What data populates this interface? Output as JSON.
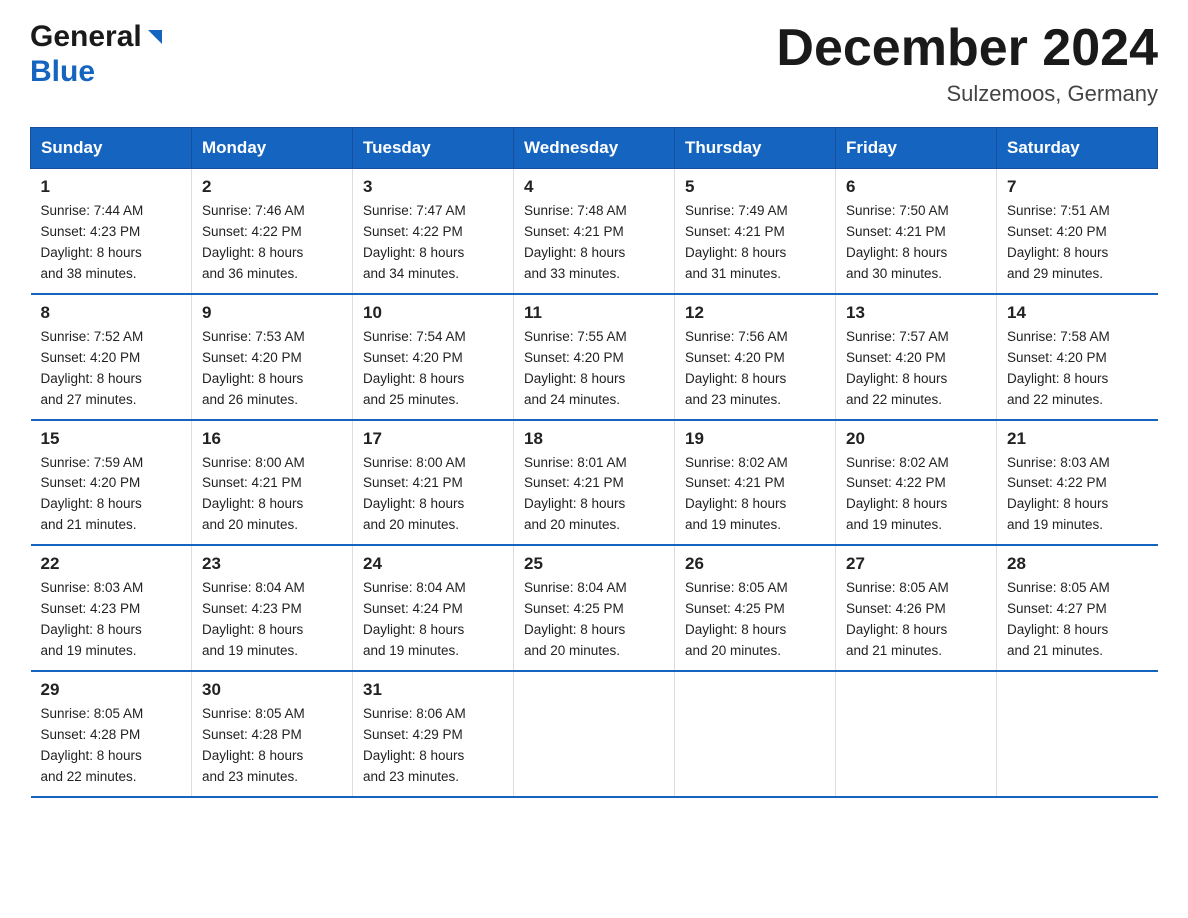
{
  "header": {
    "logo_line1": "General",
    "logo_line2": "Blue",
    "title": "December 2024",
    "location": "Sulzemoos, Germany"
  },
  "weekdays": [
    "Sunday",
    "Monday",
    "Tuesday",
    "Wednesday",
    "Thursday",
    "Friday",
    "Saturday"
  ],
  "weeks": [
    [
      {
        "day": "1",
        "sunrise": "7:44 AM",
        "sunset": "4:23 PM",
        "daylight": "8 hours and 38 minutes."
      },
      {
        "day": "2",
        "sunrise": "7:46 AM",
        "sunset": "4:22 PM",
        "daylight": "8 hours and 36 minutes."
      },
      {
        "day": "3",
        "sunrise": "7:47 AM",
        "sunset": "4:22 PM",
        "daylight": "8 hours and 34 minutes."
      },
      {
        "day": "4",
        "sunrise": "7:48 AM",
        "sunset": "4:21 PM",
        "daylight": "8 hours and 33 minutes."
      },
      {
        "day": "5",
        "sunrise": "7:49 AM",
        "sunset": "4:21 PM",
        "daylight": "8 hours and 31 minutes."
      },
      {
        "day": "6",
        "sunrise": "7:50 AM",
        "sunset": "4:21 PM",
        "daylight": "8 hours and 30 minutes."
      },
      {
        "day": "7",
        "sunrise": "7:51 AM",
        "sunset": "4:20 PM",
        "daylight": "8 hours and 29 minutes."
      }
    ],
    [
      {
        "day": "8",
        "sunrise": "7:52 AM",
        "sunset": "4:20 PM",
        "daylight": "8 hours and 27 minutes."
      },
      {
        "day": "9",
        "sunrise": "7:53 AM",
        "sunset": "4:20 PM",
        "daylight": "8 hours and 26 minutes."
      },
      {
        "day": "10",
        "sunrise": "7:54 AM",
        "sunset": "4:20 PM",
        "daylight": "8 hours and 25 minutes."
      },
      {
        "day": "11",
        "sunrise": "7:55 AM",
        "sunset": "4:20 PM",
        "daylight": "8 hours and 24 minutes."
      },
      {
        "day": "12",
        "sunrise": "7:56 AM",
        "sunset": "4:20 PM",
        "daylight": "8 hours and 23 minutes."
      },
      {
        "day": "13",
        "sunrise": "7:57 AM",
        "sunset": "4:20 PM",
        "daylight": "8 hours and 22 minutes."
      },
      {
        "day": "14",
        "sunrise": "7:58 AM",
        "sunset": "4:20 PM",
        "daylight": "8 hours and 22 minutes."
      }
    ],
    [
      {
        "day": "15",
        "sunrise": "7:59 AM",
        "sunset": "4:20 PM",
        "daylight": "8 hours and 21 minutes."
      },
      {
        "day": "16",
        "sunrise": "8:00 AM",
        "sunset": "4:21 PM",
        "daylight": "8 hours and 20 minutes."
      },
      {
        "day": "17",
        "sunrise": "8:00 AM",
        "sunset": "4:21 PM",
        "daylight": "8 hours and 20 minutes."
      },
      {
        "day": "18",
        "sunrise": "8:01 AM",
        "sunset": "4:21 PM",
        "daylight": "8 hours and 20 minutes."
      },
      {
        "day": "19",
        "sunrise": "8:02 AM",
        "sunset": "4:21 PM",
        "daylight": "8 hours and 19 minutes."
      },
      {
        "day": "20",
        "sunrise": "8:02 AM",
        "sunset": "4:22 PM",
        "daylight": "8 hours and 19 minutes."
      },
      {
        "day": "21",
        "sunrise": "8:03 AM",
        "sunset": "4:22 PM",
        "daylight": "8 hours and 19 minutes."
      }
    ],
    [
      {
        "day": "22",
        "sunrise": "8:03 AM",
        "sunset": "4:23 PM",
        "daylight": "8 hours and 19 minutes."
      },
      {
        "day": "23",
        "sunrise": "8:04 AM",
        "sunset": "4:23 PM",
        "daylight": "8 hours and 19 minutes."
      },
      {
        "day": "24",
        "sunrise": "8:04 AM",
        "sunset": "4:24 PM",
        "daylight": "8 hours and 19 minutes."
      },
      {
        "day": "25",
        "sunrise": "8:04 AM",
        "sunset": "4:25 PM",
        "daylight": "8 hours and 20 minutes."
      },
      {
        "day": "26",
        "sunrise": "8:05 AM",
        "sunset": "4:25 PM",
        "daylight": "8 hours and 20 minutes."
      },
      {
        "day": "27",
        "sunrise": "8:05 AM",
        "sunset": "4:26 PM",
        "daylight": "8 hours and 21 minutes."
      },
      {
        "day": "28",
        "sunrise": "8:05 AM",
        "sunset": "4:27 PM",
        "daylight": "8 hours and 21 minutes."
      }
    ],
    [
      {
        "day": "29",
        "sunrise": "8:05 AM",
        "sunset": "4:28 PM",
        "daylight": "8 hours and 22 minutes."
      },
      {
        "day": "30",
        "sunrise": "8:05 AM",
        "sunset": "4:28 PM",
        "daylight": "8 hours and 23 minutes."
      },
      {
        "day": "31",
        "sunrise": "8:06 AM",
        "sunset": "4:29 PM",
        "daylight": "8 hours and 23 minutes."
      },
      null,
      null,
      null,
      null
    ]
  ],
  "labels": {
    "sunrise": "Sunrise: ",
    "sunset": "Sunset: ",
    "daylight": "Daylight: "
  }
}
